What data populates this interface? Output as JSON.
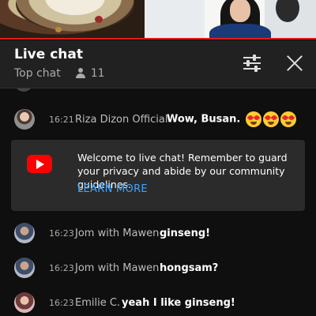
{
  "header": {
    "title": "Live chat",
    "sort_label": "Top chat",
    "viewer_count": "11"
  },
  "welcome": {
    "message": "Welcome to live chat! Remember to guard your privacy and abide by our community guidelines.",
    "learn_more": "LEARN MORE"
  },
  "messages": [
    {
      "time": "16:21",
      "author": "Riza Dizon Official",
      "text": "Wow, Busan.",
      "emoji": "heart-eyes-emoji x3"
    },
    {
      "time": "16:23",
      "author": "Jom with Mawen",
      "text": "ginseng!"
    },
    {
      "time": "16:23",
      "author": "Jom with Mawen",
      "text": "hongsam?"
    },
    {
      "time": "16:23",
      "author": "Emilie C.",
      "text": "yeah I like ginseng!"
    }
  ],
  "colors": {
    "progress": "#e11c1c",
    "link": "#3ea6ff",
    "brand": "#ff0000"
  }
}
